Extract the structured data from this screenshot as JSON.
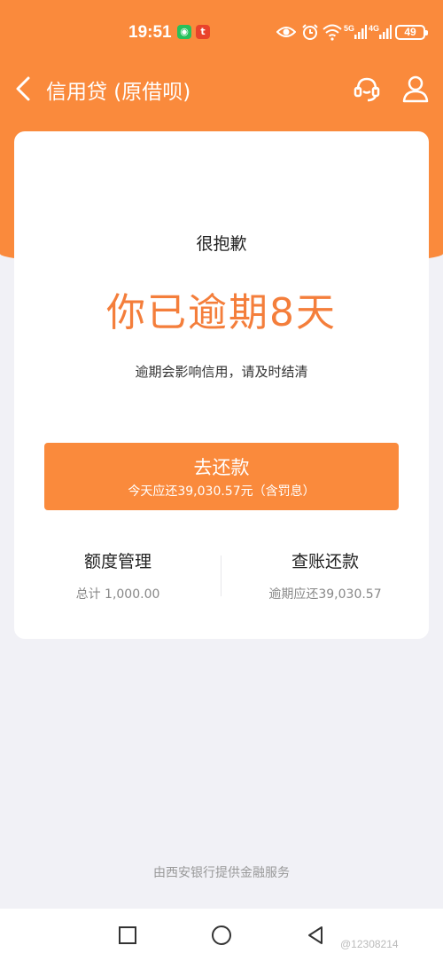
{
  "status_bar": {
    "time": "19:51",
    "battery": "49",
    "network_5g": "5G",
    "network_4g": "4G",
    "icons": [
      "wechat-icon",
      "toutiao-icon",
      "eye-icon",
      "alarm-icon",
      "wifi-icon",
      "signal-icon",
      "battery-icon"
    ]
  },
  "nav": {
    "title": "信用贷 (原借呗)",
    "icons": [
      "back-icon",
      "customer-service-icon",
      "user-icon"
    ]
  },
  "card": {
    "sorry": "很抱歉",
    "headline": "你已逾期8天",
    "note": "逾期会影响信用，请及时结清",
    "repay_button": {
      "label": "去还款",
      "sub": "今天应还39,030.57元（含罚息）"
    },
    "quota": {
      "title": "额度管理",
      "sub": "总计 1,000.00"
    },
    "bill": {
      "title": "查账还款",
      "sub": "逾期应还39,030.57"
    }
  },
  "footer": "由西安银行提供金融服务",
  "system_nav": [
    "recent-apps-icon",
    "home-icon",
    "back-triangle-icon"
  ],
  "watermark": "@12308214",
  "colors": {
    "brand_orange": "#fa8a3c",
    "headline_orange": "#f47e3b",
    "background": "#f1f1f6"
  }
}
